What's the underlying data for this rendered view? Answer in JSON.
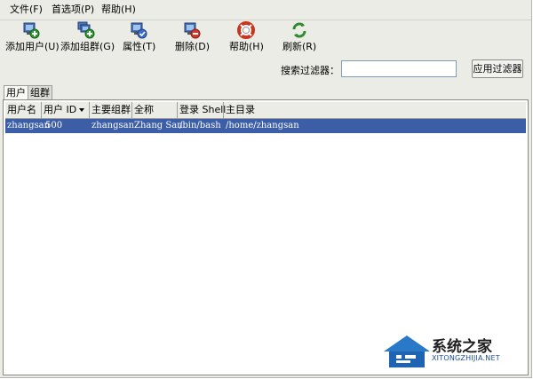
{
  "menubar": {
    "items": [
      {
        "label": "文件(F)"
      },
      {
        "label": "首选项(P)"
      },
      {
        "label": "帮助(H)"
      }
    ]
  },
  "toolbar": {
    "items": [
      {
        "label": "添加用户(U)",
        "icon": "add-user-icon"
      },
      {
        "label": "添加组群(G)",
        "icon": "add-group-icon"
      },
      {
        "label": "属性(T)",
        "icon": "properties-icon"
      },
      {
        "label": "删除(D)",
        "icon": "delete-icon"
      },
      {
        "label": "帮助(H)",
        "icon": "help-icon"
      },
      {
        "label": "刷新(R)",
        "icon": "refresh-icon"
      }
    ]
  },
  "filter": {
    "label": "搜索过滤器：",
    "value": "",
    "placeholder": "",
    "apply_label": "应用过滤器"
  },
  "tabs": [
    {
      "label": "用户",
      "active": true
    },
    {
      "label": "组群",
      "active": false
    }
  ],
  "table": {
    "columns": [
      "用户名",
      "用户 ID",
      "主要组群",
      "全称",
      "登录 Shell",
      "主目录"
    ],
    "sorted_column": "用户 ID",
    "rows": [
      [
        "zhangsan",
        "500",
        "zhangsan",
        "Zhang San",
        "/bin/bash",
        "/home/zhangsan"
      ]
    ],
    "selected_row": 0
  },
  "watermark": {
    "title": "系统之家",
    "subtitle": "XITONGZHIJIA.NET"
  },
  "colors": {
    "selection": "#3c5ea6",
    "window_bg": "#ecece6",
    "brand_blue": "#1a4f9a"
  }
}
